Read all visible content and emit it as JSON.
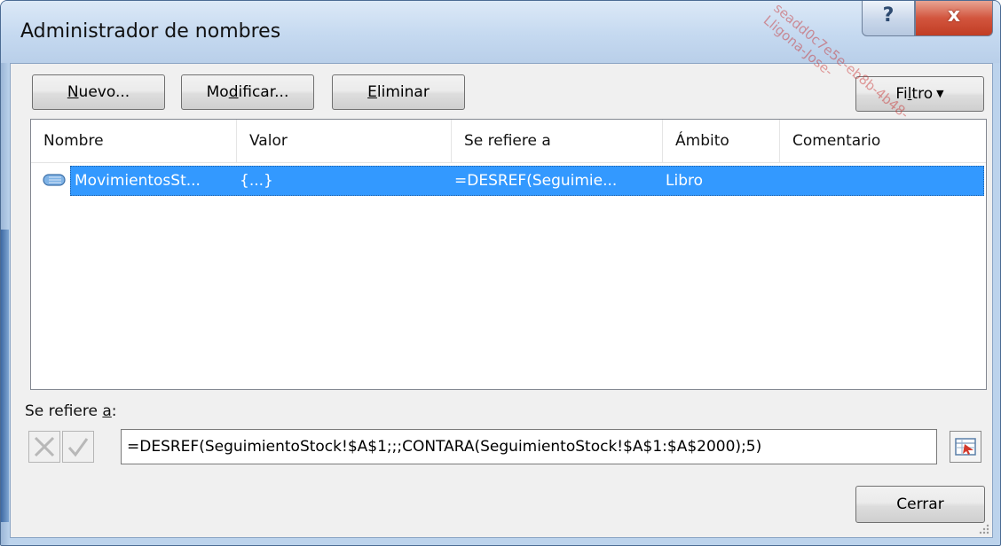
{
  "window": {
    "title": "Administrador de nombres",
    "help_glyph": "?",
    "close_glyph": "x"
  },
  "toolbar": {
    "new_prefix": "",
    "new_hot": "N",
    "new_rest": "uevo...",
    "modify_prefix": "Mo",
    "modify_hot": "d",
    "modify_rest": "ificar...",
    "delete_prefix": "",
    "delete_hot": "E",
    "delete_rest": "liminar",
    "filter_prefix": "Fi",
    "filter_hot": "l",
    "filter_rest": "tro",
    "filter_arrow": "▼"
  },
  "list": {
    "columns": [
      "Nombre",
      "Valor",
      "Se refiere a",
      "Ámbito",
      "Comentario"
    ],
    "rows": [
      {
        "name": "MovimientosSt...",
        "value": "{...}",
        "refers_to": "=DESREF(Seguimie...",
        "scope": "Libro",
        "comment": "",
        "selected": true
      }
    ]
  },
  "refers": {
    "label_prefix": "Se refiere ",
    "label_hot": "a",
    "label_suffix": ":",
    "formula": "=DESREF(SeguimientoStock!$A$1;;;CONTARA(SeguimientoStock!$A$1:$A$2000);5)"
  },
  "footer": {
    "close_label": "Cerrar"
  },
  "watermark": {
    "text": "seadd0c7e5e-eb8b-4b48-Lligona-Jose-"
  },
  "colors": {
    "selection": "#3399ff",
    "titlebar": "#c5d9f0",
    "close_button": "#c94a31"
  }
}
